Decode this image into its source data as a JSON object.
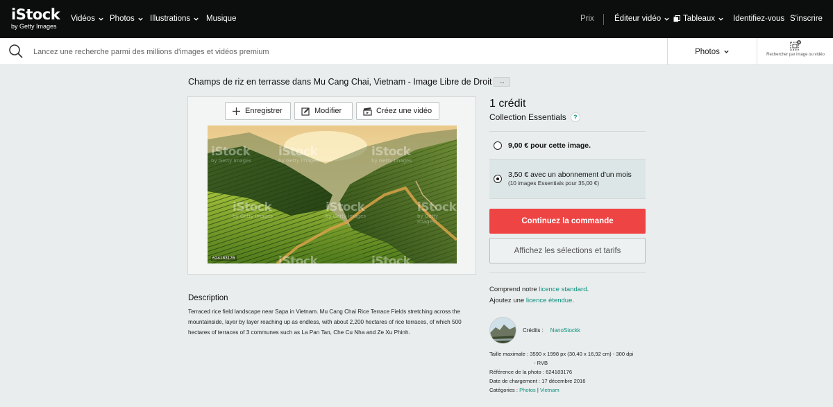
{
  "header": {
    "logo_main": "iStock",
    "logo_sub": "by Getty Images",
    "nav_left": [
      "Vidéos",
      "Photos",
      "Illustrations",
      "Musique"
    ],
    "price": "Prix",
    "video_editor": "Éditeur vidéo",
    "boards": "Tableaux",
    "sign_in": "Identifiez-vous",
    "register": "S'inscrire"
  },
  "search": {
    "placeholder": "Lancez une recherche parmi des millions d'images et vidéos premium",
    "type": "Photos",
    "image_search_label": "Rechercher par image ou vidéo"
  },
  "page": {
    "title": "Champs de riz en terrasse dans Mu Cang Chai, Vietnam - Image Libre de Droit",
    "more": "..."
  },
  "preview": {
    "save": "Enregistrer",
    "edit": "Modifier",
    "create_video": "Créez une vidéo",
    "image_id": "624183176",
    "watermark": "iStock",
    "watermark_sub": "by Getty Images"
  },
  "description": {
    "title": "Description",
    "text": "Terraced rice field landscape near Sapa in Vietnam. Mu Cang Chai Rice Terrace Fields stretching across the mountainside, layer by layer reaching up as endless, with about 2,200 hectares of rice terraces, of which 500 hectares of terraces of 3 communes such as La Pan Tan, Che Cu Nha and Ze Xu Phinh."
  },
  "purchase": {
    "credit": "1 crédit",
    "collection": "Collection Essentials",
    "help": "?",
    "option1": "9,00 € pour cette image.",
    "option2_main": "3,50 € avec un abonnement d'un mois",
    "option2_sub": "(10 images Essentials pour 35,00 €)",
    "primary_button": "Continuez la commande",
    "secondary_button": "Affichez les sélections et tarifs",
    "accent_color": "#ef4444",
    "selected_option": "option2"
  },
  "license": {
    "line1_prefix": "Comprend notre ",
    "line1_link": "licence standard",
    "line1_suffix": ".",
    "line2_prefix": "Ajoutez une ",
    "line2_link": "licence étendue",
    "line2_suffix": "."
  },
  "details": {
    "credits_label": "Crédits :",
    "credits_value": "NanoStockk",
    "max_size_label": "Taille maximale :",
    "max_size_value": "3590 x 1998 px (30,40 x 16,92 cm) - 300 dpi",
    "max_size_value2": "- RVB",
    "ref_label": "Référence de la photo :",
    "ref_value": "624183176",
    "upload_label": "Date de chargement :",
    "upload_value": "17 décembre 2016",
    "categories_label": "Catégories :",
    "category1": "Photos",
    "category_sep": "|",
    "category2": "Vietnam"
  }
}
